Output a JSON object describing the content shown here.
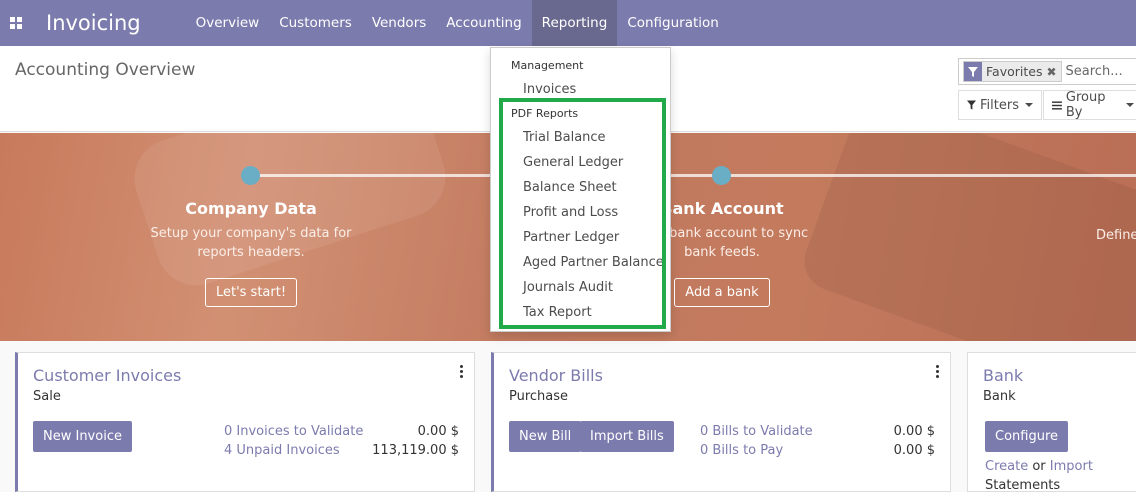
{
  "app": {
    "title": "Invoicing"
  },
  "nav": {
    "items": [
      "Overview",
      "Customers",
      "Vendors",
      "Accounting",
      "Reporting",
      "Configuration"
    ],
    "active": "Reporting"
  },
  "control_panel": {
    "page_title": "Accounting Overview",
    "facet_label": "Favorites",
    "search_placeholder": "Search...",
    "filters_label": "Filters",
    "groupby_label": "Group By"
  },
  "banner": {
    "steps": [
      {
        "title": "Company Data",
        "desc1": "Setup your company's data for",
        "desc2": "reports headers.",
        "button": "Let's start!"
      },
      {
        "title": "Bank Account",
        "desc1": "your bank account to sync",
        "desc2": "bank feeds.",
        "button": "Add a bank"
      },
      {
        "title": "Define"
      }
    ]
  },
  "cards": {
    "customer": {
      "title": "Customer Invoices",
      "subtitle": "Sale",
      "button": "New Invoice",
      "stats": [
        {
          "label": "0 Invoices to Validate",
          "value": "0.00 $"
        },
        {
          "label": "4 Unpaid Invoices",
          "value": "113,119.00 $"
        }
      ]
    },
    "vendor": {
      "title": "Vendor Bills",
      "subtitle": "Purchase",
      "button_new": "New Bill",
      "button_import": "Import Bills",
      "stats": [
        {
          "label": "0 Bills to Validate",
          "value": "0.00 $"
        },
        {
          "label": "0 Bills to Pay",
          "value": "0.00 $"
        }
      ]
    },
    "bank": {
      "title": "Bank",
      "subtitle": "Bank",
      "button": "Configure",
      "create": "Create",
      "or": "or",
      "import": "Import",
      "statements": "Statements"
    }
  },
  "reporting_menu": {
    "section_management": "Management",
    "management_items": [
      "Invoices"
    ],
    "section_pdf": "PDF Reports",
    "pdf_items": [
      "Trial Balance",
      "General Ledger",
      "Balance Sheet",
      "Profit and Loss",
      "Partner Ledger",
      "Aged Partner Balance",
      "Journals Audit",
      "Tax Report"
    ]
  },
  "colors": {
    "brand": "#7c7bad",
    "highlight": "#22a94a",
    "step_dot": "#6aaec5"
  }
}
